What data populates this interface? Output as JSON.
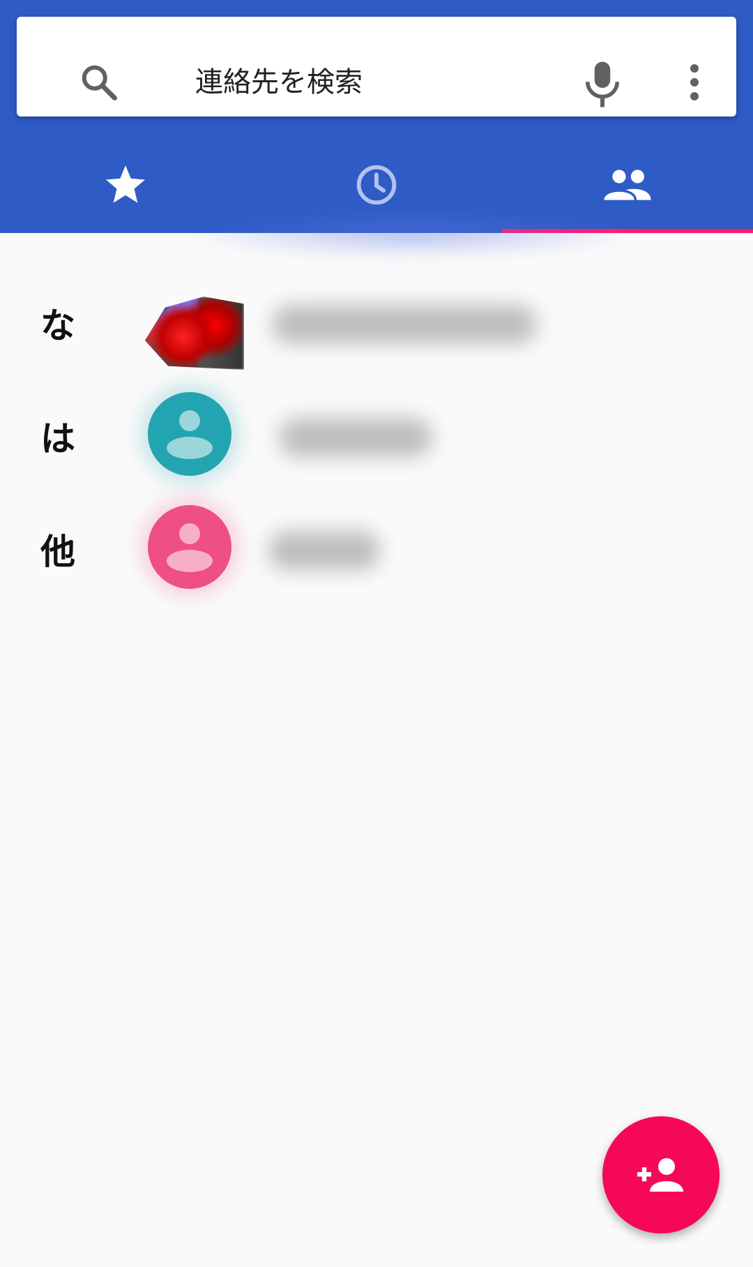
{
  "search": {
    "placeholder": "連絡先を検索"
  },
  "icons": {
    "search": "search-icon",
    "mic": "mic-icon",
    "more": "more-vert-icon",
    "favorites_tab": "star-icon",
    "recent_tab": "clock-icon",
    "contacts_tab": "people-icon",
    "add_contact": "person-add-icon"
  },
  "tabs": {
    "active": "contacts"
  },
  "contacts": {
    "sections": [
      {
        "letter": "な",
        "avatar": "photo"
      },
      {
        "letter": "は",
        "avatar": "teal"
      },
      {
        "letter": "他",
        "avatar": "pink"
      }
    ]
  },
  "colors": {
    "header": "#2f5bc6",
    "tab_indicator": "#ff1b6c",
    "fab": "#f50957",
    "avatar_teal": "#22a5b0",
    "avatar_pink": "#ee4f86",
    "background": "#fafafa"
  }
}
